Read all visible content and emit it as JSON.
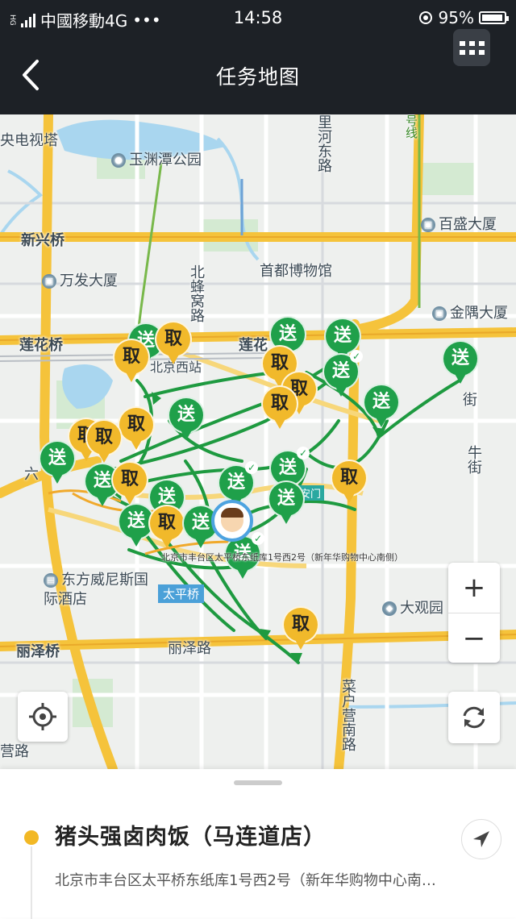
{
  "status_bar": {
    "carrier_small": "HG",
    "carrier": "中國移動4G",
    "dots": "•••",
    "time": "14:58",
    "battery": "95%",
    "battery_level": 0.95
  },
  "header": {
    "title": "任务地图",
    "icons": [
      "back-chevron-icon",
      "grid-menu-icon"
    ]
  },
  "map": {
    "labels": {
      "tv_tower": "央电视塔",
      "park": "玉渊潭公园",
      "river_road": "里河东路",
      "line_tag": "号线",
      "baisheng": "百盛大厦",
      "xinxing": "新兴桥",
      "wanfa": "万发大厦",
      "museum": "首都博物馆",
      "bei_feng": "北蜂窝路",
      "jinyu": "金隅大厦",
      "lianhua": "莲花桥",
      "lianhua2": "莲花",
      "west_station": "北京西站",
      "jie": "街",
      "niu_jie": "牛街",
      "liu": "六",
      "dongfang": "东方威尼斯国际酒店",
      "taiping_station": "太平桥",
      "daguanyuan": "大观园",
      "lize_bridge": "丽泽桥",
      "lize_road": "丽泽路",
      "caihuying": "菜户营南路",
      "gong_road": "营路",
      "anmen": "安门",
      "pin_address": "北京市丰台区太平桥东纸库1号西2号（新年华购物中心南侧）"
    },
    "pins": {
      "send": "送",
      "pick": "取"
    },
    "controls": {
      "zoom_in": "+",
      "zoom_out": "−",
      "icons": [
        "locate-icon",
        "refresh-icon"
      ]
    },
    "colors": {
      "send_pin": "#1fa04a",
      "pick_pin": "#f1b92b",
      "route": "#1e9a40",
      "main_road": "#f5c33b",
      "water": "#a9d6ef"
    }
  },
  "sheet": {
    "shop_name": "猪头强卤肉饭（马连道店）",
    "address": "北京市丰台区太平桥东纸库1号西2号（新年华购物中心南…",
    "icons": [
      "navigate-arrow-icon"
    ]
  }
}
